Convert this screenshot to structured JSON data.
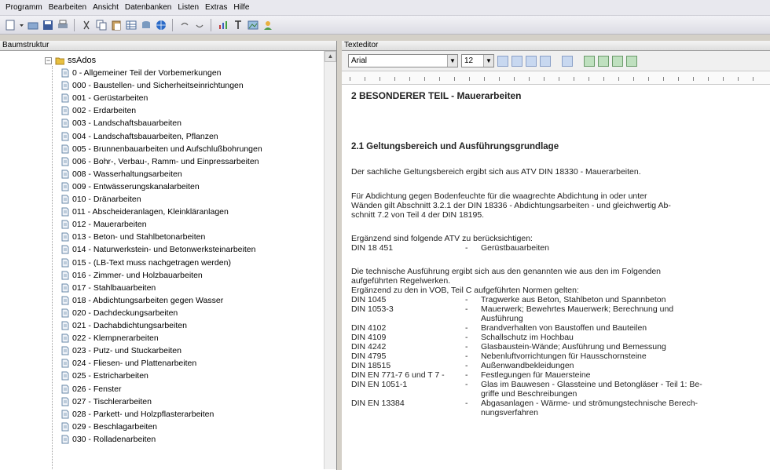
{
  "menu": [
    "Programm",
    "Bearbeiten",
    "Ansicht",
    "Datenbanken",
    "Listen",
    "Extras",
    "Hilfe"
  ],
  "left_pane": {
    "title": "Baumstruktur",
    "root_label": "ssAdos",
    "items": [
      "0 - Allgemeiner Teil der Vorbemerkungen",
      "000 - Baustellen- und Sicherheitseinrichtungen",
      "001 - Gerüstarbeiten",
      "002 - Erdarbeiten",
      "003 - Landschaftsbauarbeiten",
      "004 - Landschaftsbauarbeiten, Pflanzen",
      "005 - Brunnenbauarbeiten und Aufschlußbohrungen",
      "006 - Bohr-, Verbau-, Ramm- und Einpressarbeiten",
      "008 - Wasserhaltungsarbeiten",
      "009 - Entwässerungskanalarbeiten",
      "010 - Dränarbeiten",
      "011 - Abscheideranlagen, Kleinkläranlagen",
      "012 - Mauerarbeiten",
      "013 - Beton- und Stahlbetonarbeiten",
      "014 - Naturwerkstein- und Betonwerksteinarbeiten",
      "015 - (LB-Text muss nachgetragen werden)",
      "016 - Zimmer- und Holzbauarbeiten",
      "017 - Stahlbauarbeiten",
      "018 - Abdichtungsarbeiten gegen Wasser",
      "020 - Dachdeckungsarbeiten",
      "021 - Dachabdichtungsarbeiten",
      "022 - Klempnerarbeiten",
      "023 - Putz- und Stuckarbeiten",
      "024 - Fliesen- und Plattenarbeiten",
      "025 - Estricharbeiten",
      "026 - Fenster",
      "027 - Tischlerarbeiten",
      "028 - Parkett- und Holzpflasterarbeiten",
      "029 - Beschlagarbeiten",
      "030 - Rolladenarbeiten"
    ]
  },
  "right_pane": {
    "title": "Texteditor",
    "font_value": "Arial",
    "size_value": "12",
    "heading": "2      BESONDERER TEIL  -  Mauerarbeiten",
    "section": "2.1   Geltungsbereich und Ausführungsgrundlage",
    "para1": "Der sachliche Geltungsbereich ergibt sich aus ATV DIN 18330 - Mauerarbeiten.",
    "para2_line1": "Für Abdichtung gegen Bodenfeuchte für die waagrechte Abdichtung in oder unter",
    "para2_line2": "Wänden gilt Abschnitt 3.2.1 der DIN 18336 - Abdichtungsarbeiten - und gleichwertig Ab-",
    "para2_line3": "schnitt 7.2 von Teil 4 der DIN 18195.",
    "para3": "Ergänzend sind folgende ATV zu berücksichtigen:",
    "atv_code": "DIN 18 451",
    "atv_desc": "Gerüstbauarbeiten",
    "para4_line1": "Die technische Ausführung ergibt sich aus den genannten wie aus den im Folgenden",
    "para4_line2": "aufgeführten Regelwerken.",
    "para4_line3": "Ergänzend zu den in VOB, Teil C aufgeführten Normen gelten:",
    "norms": [
      {
        "code": "DIN 1045",
        "desc": "Tragwerke aus Beton, Stahlbeton und Spannbeton",
        "desc2": ""
      },
      {
        "code": "DIN 1053-3",
        "desc": "Mauerwerk; Bewehrtes Mauerwerk; Berechnung und",
        "desc2": "Ausführung"
      },
      {
        "code": "DIN 4102",
        "desc": "Brandverhalten von Baustoffen und Bauteilen",
        "desc2": ""
      },
      {
        "code": "DIN 4109",
        "desc": "Schallschutz im Hochbau",
        "desc2": ""
      },
      {
        "code": "DIN 4242",
        "desc": "Glasbaustein-Wände; Ausführung und Bemessung",
        "desc2": ""
      },
      {
        "code": "DIN 4795",
        "desc": "Nebenluftvorrichtungen für Hausschornsteine",
        "desc2": ""
      },
      {
        "code": "DIN 18515",
        "desc": "Außenwandbekleidungen",
        "desc2": ""
      },
      {
        "code": "DIN EN 771-7 6 und T 7 -",
        "desc": "Festlegungen für Mauersteine",
        "desc2": ""
      },
      {
        "code": "DIN EN 1051-1",
        "desc": "Glas im Bauwesen - Glassteine und Betongläser - Teil 1: Be-",
        "desc2": "griffe und Beschreibungen"
      },
      {
        "code": "DIN EN 13384",
        "desc": "Abgasanlagen - Wärme- und strömungstechnische Berech-",
        "desc2": "nungsverfahren"
      }
    ]
  },
  "colors": {
    "tree_folder": "#e8c040",
    "doc_icon": "#6a8aa8",
    "accent": "#3a70c8"
  }
}
